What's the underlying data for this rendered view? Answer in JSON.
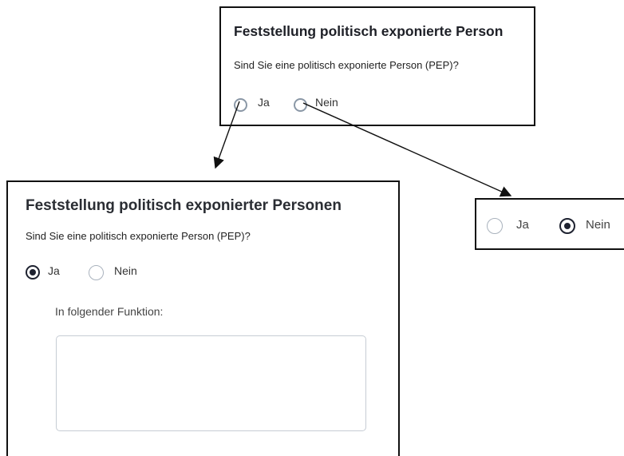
{
  "top_panel": {
    "title": "Feststellung politisch exponierte Person",
    "question": "Sind Sie eine politisch exponierte Person (PEP)?",
    "option_yes": "Ja",
    "option_no": "Nein"
  },
  "main_panel": {
    "title": "Feststellung politisch exponierter Personen",
    "question": "Sind Sie eine politisch exponierte Person (PEP)?",
    "option_yes": "Ja",
    "option_no": "Nein",
    "selected": "Ja",
    "function_label": "In folgender Funktion:",
    "function_value": ""
  },
  "right_panel": {
    "option_yes": "Ja",
    "option_no": "Nein",
    "selected": "Nein"
  },
  "colors": {
    "border": "#111111",
    "radio_selected": "#1e2230",
    "radio_unselected": "#a9b2bd",
    "input_border": "#c6ccd4"
  }
}
